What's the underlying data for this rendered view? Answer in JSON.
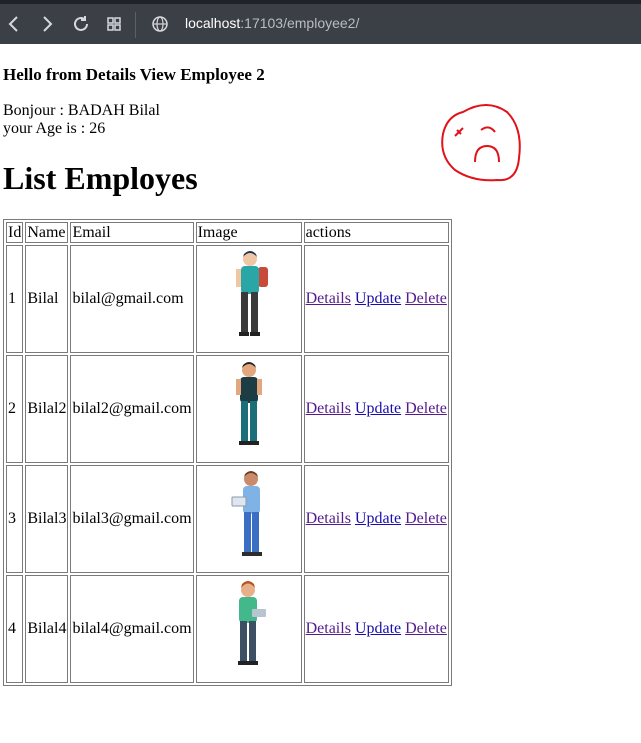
{
  "browser": {
    "url_host": "localhost",
    "url_rest": ":17103/employee2/"
  },
  "page": {
    "heading": "Hello from Details View Employee 2",
    "greeting": "Bonjour : BADAH Bilal",
    "age_line": "your Age is : 26",
    "list_title": "List Employes"
  },
  "table": {
    "headers": [
      "Id",
      "Name",
      "Email",
      "Image",
      "actions"
    ],
    "rows": [
      {
        "id": "1",
        "name": "Bilal",
        "email": "bilal@gmail.com"
      },
      {
        "id": "2",
        "name": "Bilal2",
        "email": "bilal2@gmail.com"
      },
      {
        "id": "3",
        "name": "Bilal3",
        "email": "bilal3@gmail.com"
      },
      {
        "id": "4",
        "name": "Bilal4",
        "email": "bilal4@gmail.com"
      }
    ],
    "actions": {
      "details": "Details",
      "update": "Update",
      "delete": "Delete"
    }
  },
  "icons": {
    "back": "arrow-left-icon",
    "forward": "arrow-right-icon",
    "reload": "reload-icon",
    "tabs": "grid-icon",
    "site": "globe-icon"
  },
  "colors": {
    "link_visited": "#551a8b",
    "link": "#1a0dab",
    "doodle": "#e0131a"
  }
}
